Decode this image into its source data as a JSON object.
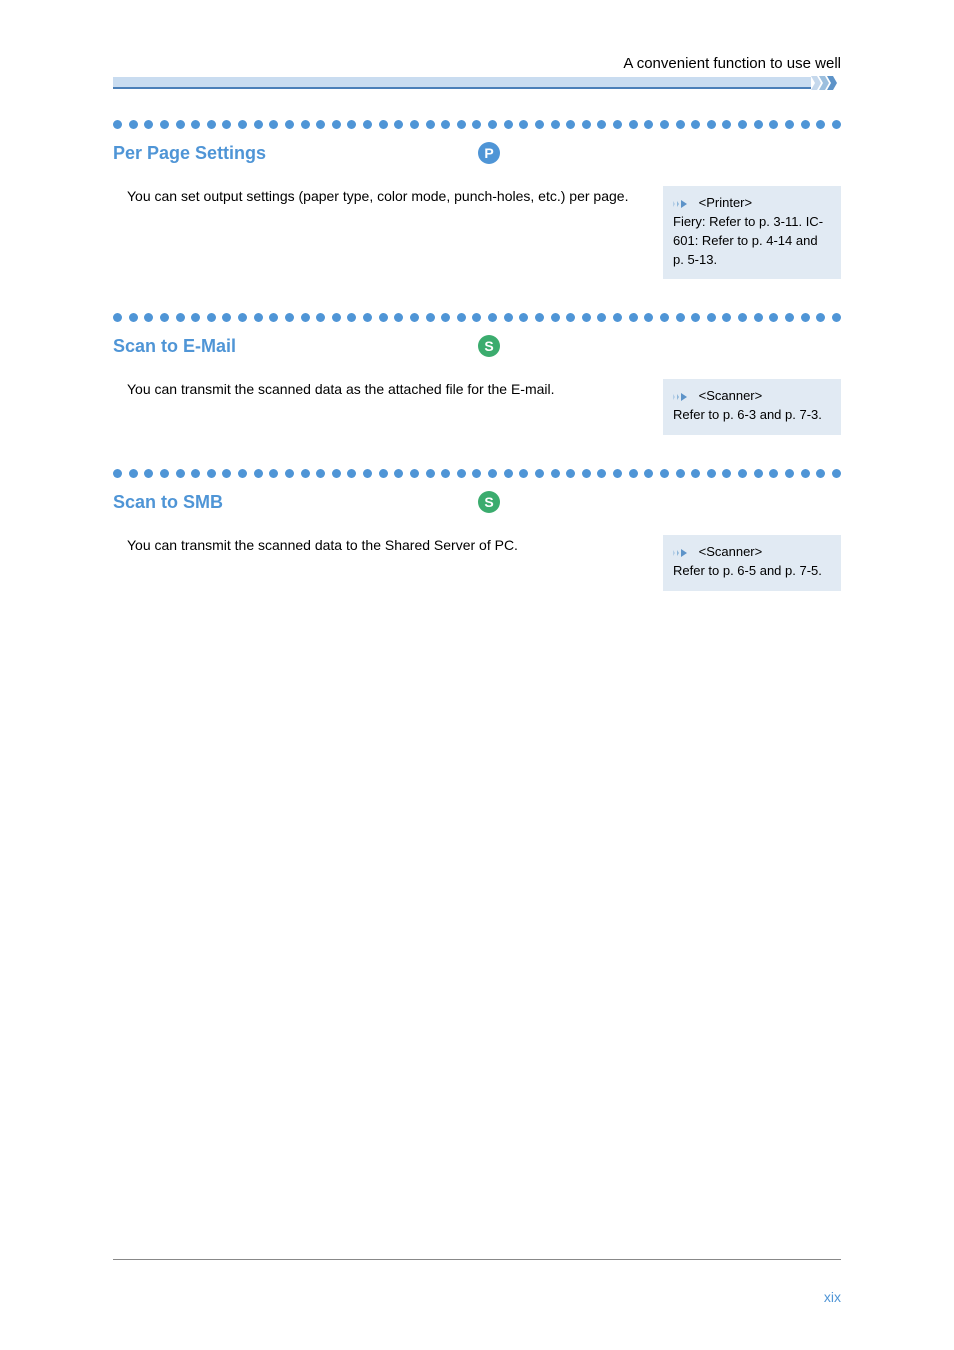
{
  "header": {
    "running_title": "A convenient function to use well"
  },
  "sections": [
    {
      "heading": "Per Page Settings",
      "badge": "P",
      "description": "You can set output settings (paper type, color mode, punch-holes, etc.) per page.",
      "info": {
        "title": "<Printer>",
        "text": "Fiery: Refer to p. 3-11. IC-601: Refer to p. 4-14 and p. 5-13."
      }
    },
    {
      "heading": "Scan to E-Mail",
      "badge": "S",
      "description": "You can transmit the scanned data as the attached file for the E-mail.",
      "info": {
        "title": "<Scanner>",
        "text": "Refer to p. 6-3 and p. 7-3."
      }
    },
    {
      "heading": "Scan to SMB",
      "badge": "S",
      "description": "You can transmit the scanned data to the Shared Server of PC.",
      "info": {
        "title": "<Scanner>",
        "text": "Refer to p. 6-5 and p. 7-5."
      }
    }
  ],
  "footer": {
    "page_number": "xix"
  }
}
